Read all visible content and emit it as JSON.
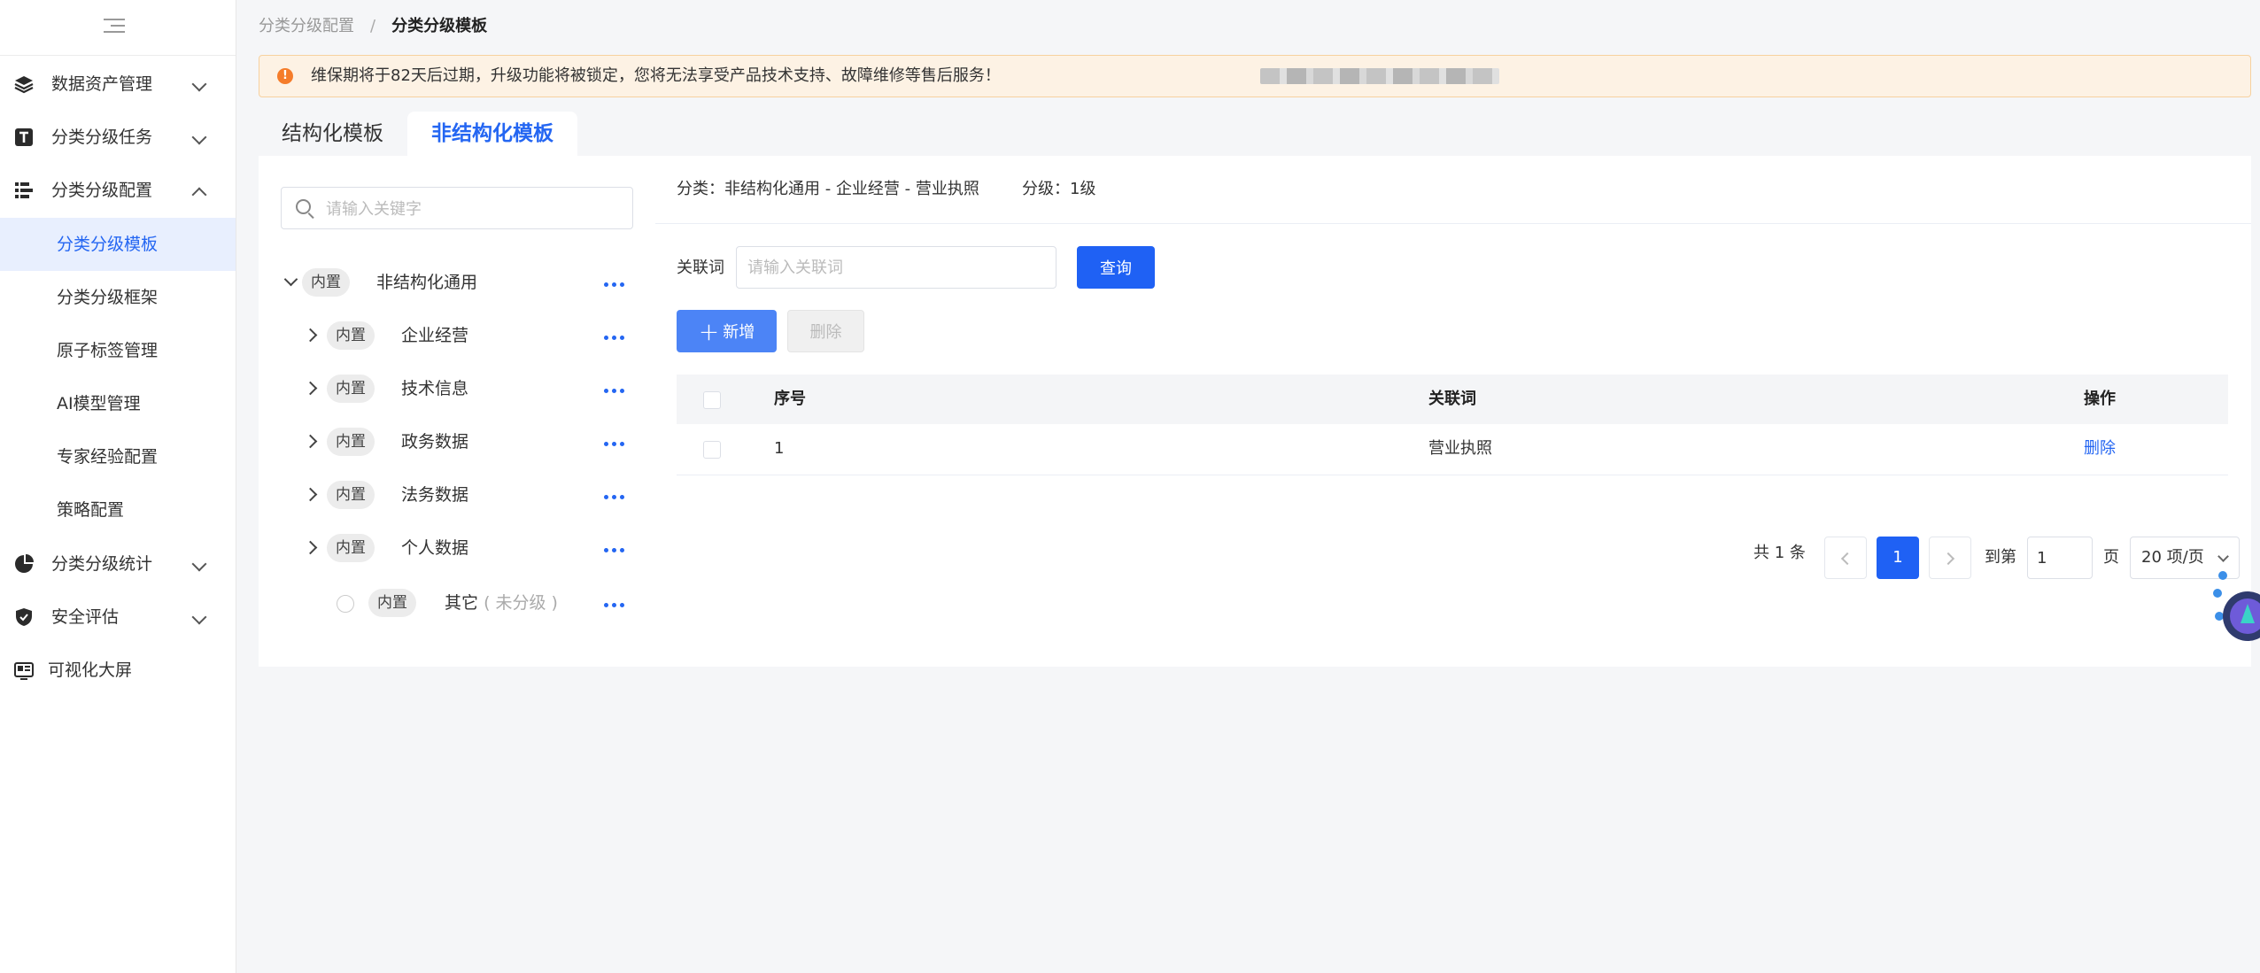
{
  "sidebar": {
    "items": [
      {
        "label": "数据资产管理",
        "icon": "layers-icon"
      },
      {
        "label": "分类分级任务",
        "icon": "task-t-icon"
      },
      {
        "label": "分类分级配置",
        "icon": "config-list-icon"
      },
      {
        "label": "分类分级统计",
        "icon": "pie-chart-icon"
      },
      {
        "label": "安全评估",
        "icon": "shield-check-icon"
      },
      {
        "label": "可视化大屏",
        "icon": "screen-icon"
      }
    ],
    "subitems": [
      "分类分级模板",
      "分类分级框架",
      "原子标签管理",
      "AI模型管理",
      "专家经验配置",
      "策略配置"
    ],
    "active_subitem": "分类分级模板"
  },
  "breadcrumb": {
    "parent": "分类分级配置",
    "separator": "/",
    "current": "分类分级模板"
  },
  "notice": {
    "text": "维保期将于82天后过期，升级功能将被锁定，您将无法享受产品技术支持、故障维修等售后服务！",
    "accent": "#f57c2a"
  },
  "tabs": [
    {
      "label": "结构化模板"
    },
    {
      "label": "非结构化模板",
      "active": true
    }
  ],
  "tree": {
    "search_placeholder": "请输入关键字",
    "nodes": [
      {
        "badge": "内置",
        "label": "非结构化通用"
      },
      {
        "badge": "内置",
        "label": "企业经营"
      },
      {
        "badge": "内置",
        "label": "技术信息"
      },
      {
        "badge": "内置",
        "label": "政务数据"
      },
      {
        "badge": "内置",
        "label": "法务数据"
      },
      {
        "badge": "内置",
        "label": "个人数据"
      },
      {
        "badge": "内置",
        "label": "其它",
        "suffix": "( 未分级 )"
      }
    ]
  },
  "info": {
    "category": "分类：非结构化通用 - 企业经营 - 营业执照",
    "level": "分级：1级"
  },
  "filter": {
    "label": "关联词",
    "placeholder": "请输入关联词",
    "query_button": "查询"
  },
  "actions": {
    "add": "新增",
    "delete": "删除"
  },
  "table": {
    "columns": [
      "序号",
      "关联词",
      "操作"
    ],
    "rows": [
      {
        "index": "1",
        "keyword": "营业执照",
        "action": "删除"
      }
    ]
  },
  "pagination": {
    "total": "共 1 条",
    "current": "1",
    "goto_label": "到第",
    "goto_value": "1",
    "page_unit": "页",
    "page_size": "20 项/页"
  },
  "colors": {
    "primary": "#1f61f4",
    "active_bg": "#e8effe",
    "notice_bg": "#fdf2e4"
  }
}
